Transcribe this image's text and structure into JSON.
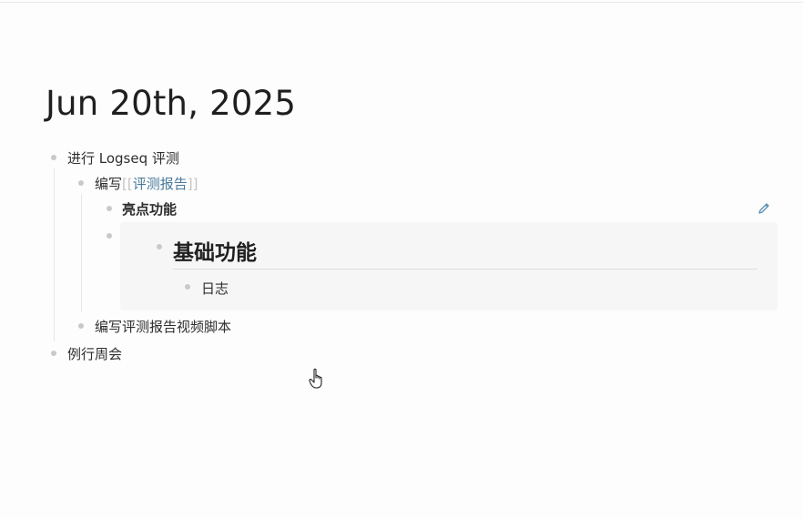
{
  "page": {
    "title": "Jun 20th, 2025"
  },
  "blocks": {
    "b1": "进行 Logseq 评测",
    "b1_1_prefix": "编写",
    "b1_1_ref_open": "[[",
    "b1_1_ref": "评测报告",
    "b1_1_ref_close": "]]",
    "b1_1_1": "亮点功能",
    "embed_heading": "基础功能",
    "embed_child": "日志",
    "b1_2": "编写评测报告视频脚本",
    "b2": "例行周会"
  },
  "icons": {
    "edit": "pencil-icon",
    "cursor": "hand-pointer-cursor"
  },
  "colors": {
    "link": "#4a7a9a",
    "bullet": "#c9c9c9",
    "embed_bg": "#f6f6f6"
  }
}
